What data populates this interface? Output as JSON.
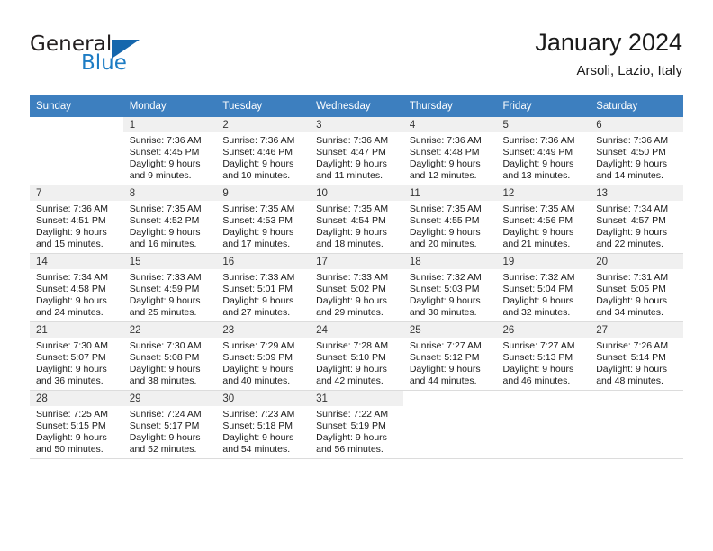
{
  "brand": {
    "name_part1": "General",
    "name_part2": "Blue",
    "triangle_color": "#1567ad",
    "blue_color": "#1d7cc4"
  },
  "header": {
    "title": "January 2024",
    "subtitle": "Arsoli, Lazio, Italy"
  },
  "theme": {
    "header_row_bg": "#3d7fbf",
    "header_row_text": "#ffffff",
    "day_cell_header_bg": "#f0f0f0",
    "grid_line": "#dcdcdc"
  },
  "weekdays": [
    "Sunday",
    "Monday",
    "Tuesday",
    "Wednesday",
    "Thursday",
    "Friday",
    "Saturday"
  ],
  "weeks": [
    [
      {
        "day": "",
        "sunrise": "",
        "sunset": "",
        "daylight1": "",
        "daylight2": ""
      },
      {
        "day": "1",
        "sunrise": "Sunrise: 7:36 AM",
        "sunset": "Sunset: 4:45 PM",
        "daylight1": "Daylight: 9 hours",
        "daylight2": "and 9 minutes."
      },
      {
        "day": "2",
        "sunrise": "Sunrise: 7:36 AM",
        "sunset": "Sunset: 4:46 PM",
        "daylight1": "Daylight: 9 hours",
        "daylight2": "and 10 minutes."
      },
      {
        "day": "3",
        "sunrise": "Sunrise: 7:36 AM",
        "sunset": "Sunset: 4:47 PM",
        "daylight1": "Daylight: 9 hours",
        "daylight2": "and 11 minutes."
      },
      {
        "day": "4",
        "sunrise": "Sunrise: 7:36 AM",
        "sunset": "Sunset: 4:48 PM",
        "daylight1": "Daylight: 9 hours",
        "daylight2": "and 12 minutes."
      },
      {
        "day": "5",
        "sunrise": "Sunrise: 7:36 AM",
        "sunset": "Sunset: 4:49 PM",
        "daylight1": "Daylight: 9 hours",
        "daylight2": "and 13 minutes."
      },
      {
        "day": "6",
        "sunrise": "Sunrise: 7:36 AM",
        "sunset": "Sunset: 4:50 PM",
        "daylight1": "Daylight: 9 hours",
        "daylight2": "and 14 minutes."
      }
    ],
    [
      {
        "day": "7",
        "sunrise": "Sunrise: 7:36 AM",
        "sunset": "Sunset: 4:51 PM",
        "daylight1": "Daylight: 9 hours",
        "daylight2": "and 15 minutes."
      },
      {
        "day": "8",
        "sunrise": "Sunrise: 7:35 AM",
        "sunset": "Sunset: 4:52 PM",
        "daylight1": "Daylight: 9 hours",
        "daylight2": "and 16 minutes."
      },
      {
        "day": "9",
        "sunrise": "Sunrise: 7:35 AM",
        "sunset": "Sunset: 4:53 PM",
        "daylight1": "Daylight: 9 hours",
        "daylight2": "and 17 minutes."
      },
      {
        "day": "10",
        "sunrise": "Sunrise: 7:35 AM",
        "sunset": "Sunset: 4:54 PM",
        "daylight1": "Daylight: 9 hours",
        "daylight2": "and 18 minutes."
      },
      {
        "day": "11",
        "sunrise": "Sunrise: 7:35 AM",
        "sunset": "Sunset: 4:55 PM",
        "daylight1": "Daylight: 9 hours",
        "daylight2": "and 20 minutes."
      },
      {
        "day": "12",
        "sunrise": "Sunrise: 7:35 AM",
        "sunset": "Sunset: 4:56 PM",
        "daylight1": "Daylight: 9 hours",
        "daylight2": "and 21 minutes."
      },
      {
        "day": "13",
        "sunrise": "Sunrise: 7:34 AM",
        "sunset": "Sunset: 4:57 PM",
        "daylight1": "Daylight: 9 hours",
        "daylight2": "and 22 minutes."
      }
    ],
    [
      {
        "day": "14",
        "sunrise": "Sunrise: 7:34 AM",
        "sunset": "Sunset: 4:58 PM",
        "daylight1": "Daylight: 9 hours",
        "daylight2": "and 24 minutes."
      },
      {
        "day": "15",
        "sunrise": "Sunrise: 7:33 AM",
        "sunset": "Sunset: 4:59 PM",
        "daylight1": "Daylight: 9 hours",
        "daylight2": "and 25 minutes."
      },
      {
        "day": "16",
        "sunrise": "Sunrise: 7:33 AM",
        "sunset": "Sunset: 5:01 PM",
        "daylight1": "Daylight: 9 hours",
        "daylight2": "and 27 minutes."
      },
      {
        "day": "17",
        "sunrise": "Sunrise: 7:33 AM",
        "sunset": "Sunset: 5:02 PM",
        "daylight1": "Daylight: 9 hours",
        "daylight2": "and 29 minutes."
      },
      {
        "day": "18",
        "sunrise": "Sunrise: 7:32 AM",
        "sunset": "Sunset: 5:03 PM",
        "daylight1": "Daylight: 9 hours",
        "daylight2": "and 30 minutes."
      },
      {
        "day": "19",
        "sunrise": "Sunrise: 7:32 AM",
        "sunset": "Sunset: 5:04 PM",
        "daylight1": "Daylight: 9 hours",
        "daylight2": "and 32 minutes."
      },
      {
        "day": "20",
        "sunrise": "Sunrise: 7:31 AM",
        "sunset": "Sunset: 5:05 PM",
        "daylight1": "Daylight: 9 hours",
        "daylight2": "and 34 minutes."
      }
    ],
    [
      {
        "day": "21",
        "sunrise": "Sunrise: 7:30 AM",
        "sunset": "Sunset: 5:07 PM",
        "daylight1": "Daylight: 9 hours",
        "daylight2": "and 36 minutes."
      },
      {
        "day": "22",
        "sunrise": "Sunrise: 7:30 AM",
        "sunset": "Sunset: 5:08 PM",
        "daylight1": "Daylight: 9 hours",
        "daylight2": "and 38 minutes."
      },
      {
        "day": "23",
        "sunrise": "Sunrise: 7:29 AM",
        "sunset": "Sunset: 5:09 PM",
        "daylight1": "Daylight: 9 hours",
        "daylight2": "and 40 minutes."
      },
      {
        "day": "24",
        "sunrise": "Sunrise: 7:28 AM",
        "sunset": "Sunset: 5:10 PM",
        "daylight1": "Daylight: 9 hours",
        "daylight2": "and 42 minutes."
      },
      {
        "day": "25",
        "sunrise": "Sunrise: 7:27 AM",
        "sunset": "Sunset: 5:12 PM",
        "daylight1": "Daylight: 9 hours",
        "daylight2": "and 44 minutes."
      },
      {
        "day": "26",
        "sunrise": "Sunrise: 7:27 AM",
        "sunset": "Sunset: 5:13 PM",
        "daylight1": "Daylight: 9 hours",
        "daylight2": "and 46 minutes."
      },
      {
        "day": "27",
        "sunrise": "Sunrise: 7:26 AM",
        "sunset": "Sunset: 5:14 PM",
        "daylight1": "Daylight: 9 hours",
        "daylight2": "and 48 minutes."
      }
    ],
    [
      {
        "day": "28",
        "sunrise": "Sunrise: 7:25 AM",
        "sunset": "Sunset: 5:15 PM",
        "daylight1": "Daylight: 9 hours",
        "daylight2": "and 50 minutes."
      },
      {
        "day": "29",
        "sunrise": "Sunrise: 7:24 AM",
        "sunset": "Sunset: 5:17 PM",
        "daylight1": "Daylight: 9 hours",
        "daylight2": "and 52 minutes."
      },
      {
        "day": "30",
        "sunrise": "Sunrise: 7:23 AM",
        "sunset": "Sunset: 5:18 PM",
        "daylight1": "Daylight: 9 hours",
        "daylight2": "and 54 minutes."
      },
      {
        "day": "31",
        "sunrise": "Sunrise: 7:22 AM",
        "sunset": "Sunset: 5:19 PM",
        "daylight1": "Daylight: 9 hours",
        "daylight2": "and 56 minutes."
      },
      {
        "day": "",
        "sunrise": "",
        "sunset": "",
        "daylight1": "",
        "daylight2": ""
      },
      {
        "day": "",
        "sunrise": "",
        "sunset": "",
        "daylight1": "",
        "daylight2": ""
      },
      {
        "day": "",
        "sunrise": "",
        "sunset": "",
        "daylight1": "",
        "daylight2": ""
      }
    ]
  ]
}
